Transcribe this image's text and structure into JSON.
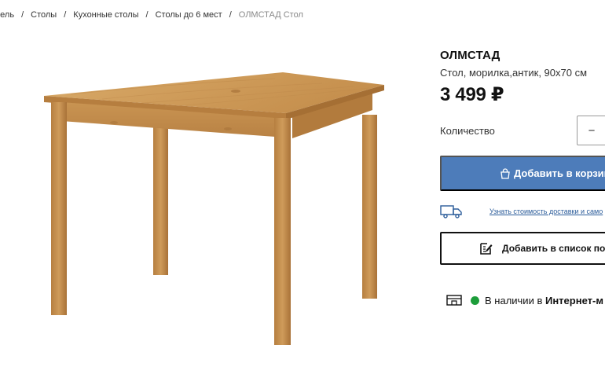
{
  "breadcrumb": {
    "items": [
      "бель",
      "Столы",
      "Кухонные столы",
      "Столы до 6 мест"
    ],
    "current": "ОЛМСТАД Стол",
    "separator": "/"
  },
  "product": {
    "name": "ОЛМСТАД",
    "description": "Стол, морилка,антик, 90x70 см",
    "price": "3 499 ₽",
    "image_alt": "table-photo"
  },
  "quantity": {
    "label": "Количество",
    "minus": "−"
  },
  "buttons": {
    "add_to_cart": "Добавить в корзин",
    "add_to_list": "Добавить в список пок"
  },
  "delivery": {
    "link": "Узнать стоимость доставки и само"
  },
  "stock": {
    "status": "В наличии в",
    "place": "Интернет-м"
  },
  "colors": {
    "accent": "#4d7cba",
    "in_stock": "#1c9d3a",
    "wood_light": "#c99a5c",
    "wood_dark": "#a8743a"
  },
  "icons": [
    "shopping-bag-icon",
    "truck-icon",
    "edit-list-icon",
    "store-icon",
    "status-dot-icon"
  ]
}
